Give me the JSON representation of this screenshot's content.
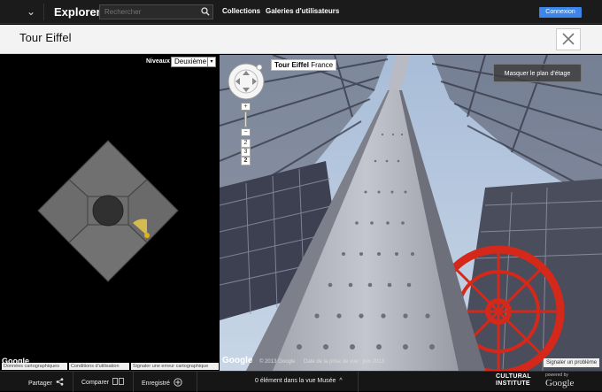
{
  "header": {
    "menu_glyph": "⌄",
    "brand": "Explorer",
    "search_placeholder": "Rechercher",
    "nav": [
      "Collections",
      "Galeries d'utilisateurs"
    ],
    "login": "Connexion"
  },
  "title": "Tour Eiffel",
  "map": {
    "levels_label": "Niveaux",
    "level_value": "Deuxième",
    "google": "Google",
    "footer": [
      "Données cartographiques",
      "Conditions d'utilisation",
      "Signaler une erreur cartographique"
    ]
  },
  "pano": {
    "place": "Tour Eiffel",
    "country": "France",
    "floorplan_toggle": "Masquer le plan d'étage",
    "zoom_in": "+",
    "zoom_out": "−",
    "levels": [
      "2",
      "3",
      "2"
    ],
    "copyright": "© 2013 Google",
    "date": "Date de la prise de vue : juin 2013",
    "report": "Signaler un problème",
    "google": "Google"
  },
  "bottom": {
    "share": "Partager",
    "compare": "Comparer",
    "saved": "Enregistré",
    "museum": "0 élément dans la vue Musée",
    "ci_line1": "CULTURAL",
    "ci_line2": "INSTITUTE",
    "powered": "powered by",
    "google": "Google"
  },
  "colors": {
    "accent": "#3b86e8",
    "topbar": "#1b1b1b",
    "titlebar": "#f3f3f3",
    "map_tile": "#6e6e6e"
  }
}
